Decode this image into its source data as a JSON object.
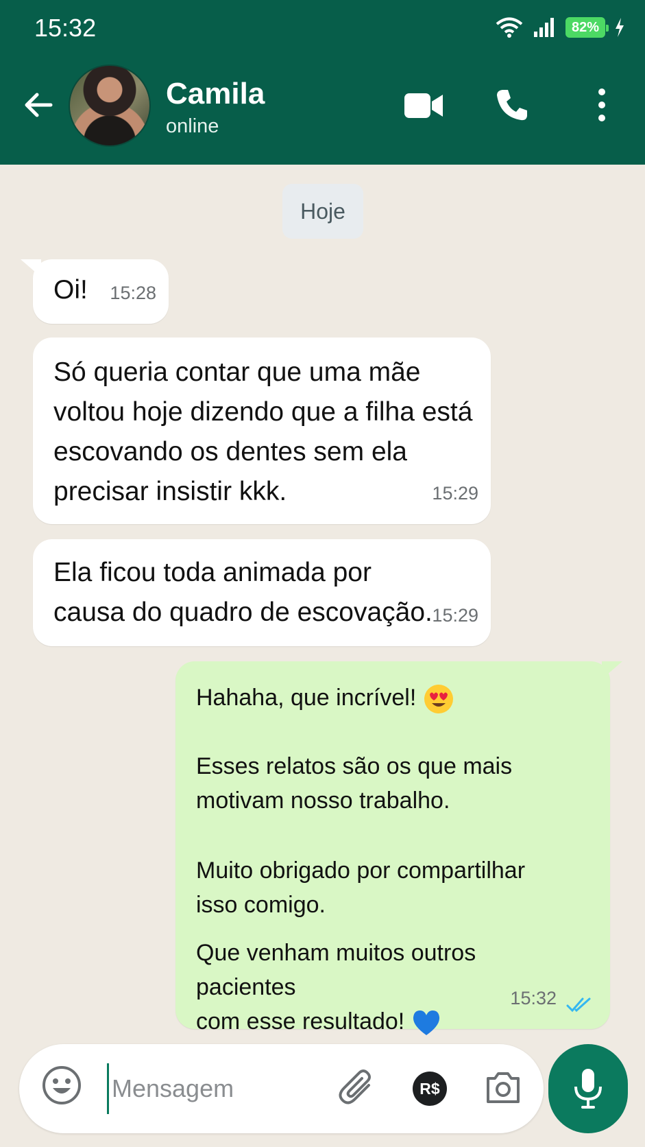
{
  "status_bar": {
    "time": "15:32",
    "battery": "82%"
  },
  "header": {
    "contact_name": "Camila",
    "contact_status": "online"
  },
  "date_chip": "Hoje",
  "messages": [
    {
      "text": "Oi!",
      "time": "15:28"
    },
    {
      "text": "Só queria contar que uma mãe\nvoltou hoje dizendo que a filha está\nescovando os dentes sem ela\nprecisar insistir kkk.",
      "time": "15:29"
    },
    {
      "text": "Ela ficou toda animada por\ncausa do quadro de escovação.",
      "time": "15:29"
    },
    {
      "p1": "Hahaha, que incrível!",
      "p2": "Esses relatos são os que mais\nmotivam nosso trabalho.",
      "p3": "Muito obrigado por compartilhar\nisso comigo.",
      "p4": "Que venham muitos outros pacientes\ncom esse resultado!",
      "time": "15:32",
      "emoji1": "smiling-face-with-heart-eyes",
      "emoji2": "blue-heart"
    }
  ],
  "composer": {
    "placeholder": "Mensagem",
    "payment_label": "R$"
  },
  "colors": {
    "header": "#075e4a",
    "outgoing_bubble": "#d9f7c5",
    "read_ticks": "#34b7f1",
    "mic": "#0b7a5e"
  }
}
